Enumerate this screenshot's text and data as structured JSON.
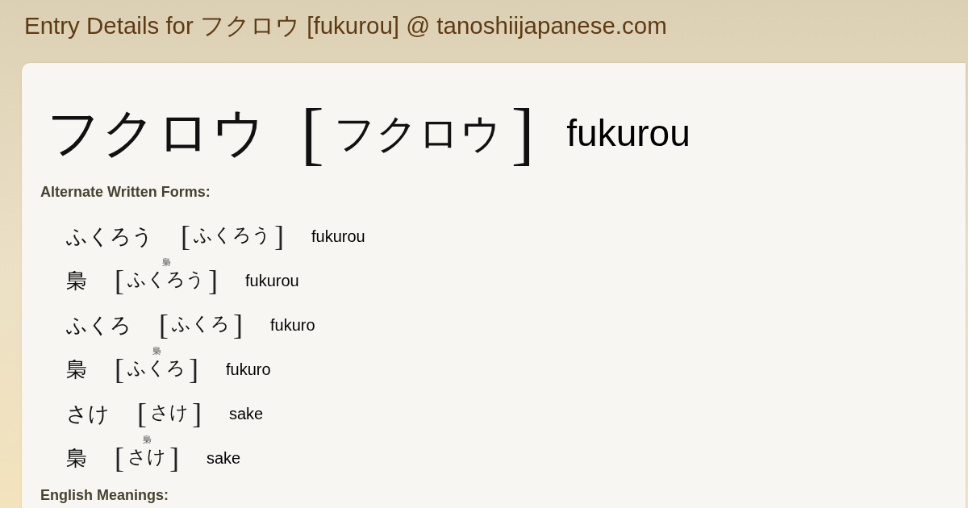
{
  "page_title": "Entry Details for フクロウ [fukurou] @ tanoshiijapanese.com",
  "entry": {
    "written": "フクロウ",
    "bracket_open": "[",
    "reading": "フクロウ",
    "bracket_close": "]",
    "romaji": "fukurou"
  },
  "alternate_forms": {
    "heading": "Alternate Written Forms:",
    "forms": [
      {
        "written": "ふくろう",
        "bracket_open": "[",
        "reading": "ふくろう",
        "bracket_close": "]",
        "romaji": "fukurou"
      },
      {
        "written": "梟",
        "bracket_open": "[",
        "ruby": "梟",
        "reading": "ふくろう",
        "bracket_close": "]",
        "romaji": "fukurou"
      },
      {
        "written": "ふくろ",
        "bracket_open": "[",
        "reading": "ふくろ",
        "bracket_close": "]",
        "romaji": "fukuro"
      },
      {
        "written": "梟",
        "bracket_open": "[",
        "ruby": "梟",
        "reading": "ふくろ",
        "bracket_close": "]",
        "romaji": "fukuro"
      },
      {
        "written": "さけ",
        "bracket_open": "[",
        "reading": "さけ",
        "bracket_close": "]",
        "romaji": "sake"
      },
      {
        "written": "梟",
        "bracket_open": "[",
        "ruby": "梟",
        "reading": "さけ",
        "bracket_close": "]",
        "romaji": "sake"
      }
    ]
  },
  "english_meanings": {
    "heading": "English Meanings:"
  }
}
